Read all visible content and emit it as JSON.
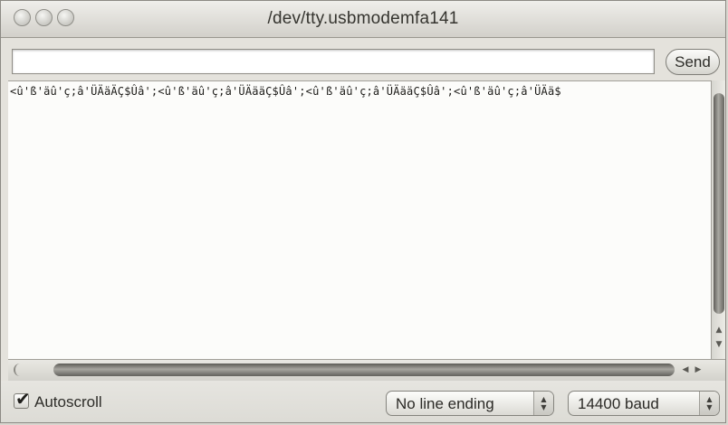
{
  "window": {
    "title": "/dev/tty.usbmodemfa141"
  },
  "send_bar": {
    "input_value": "",
    "input_placeholder": "",
    "send_label": "Send"
  },
  "console": {
    "line": "<û'ß'äû'ç;â'ÜÄäÄÇ$Ûâ';<û'ß'äû'ç;â'ÜÄääÇ$Ûâ';<û'ß'äû'ç;â'ÜÄääÇ$Ûâ';<û'ß'äû'ç;â'ÜÄä$"
  },
  "footer": {
    "autoscroll_label": "Autoscroll",
    "autoscroll_checked": true,
    "line_ending_selected": "No line ending",
    "baud_selected": "14400 baud"
  },
  "icons": {
    "checkmark": "✔",
    "scroll_up": "▲",
    "scroll_down": "▼",
    "scroll_left": "◀",
    "scroll_right": "▶",
    "select_up": "▲",
    "select_down": "▼"
  }
}
